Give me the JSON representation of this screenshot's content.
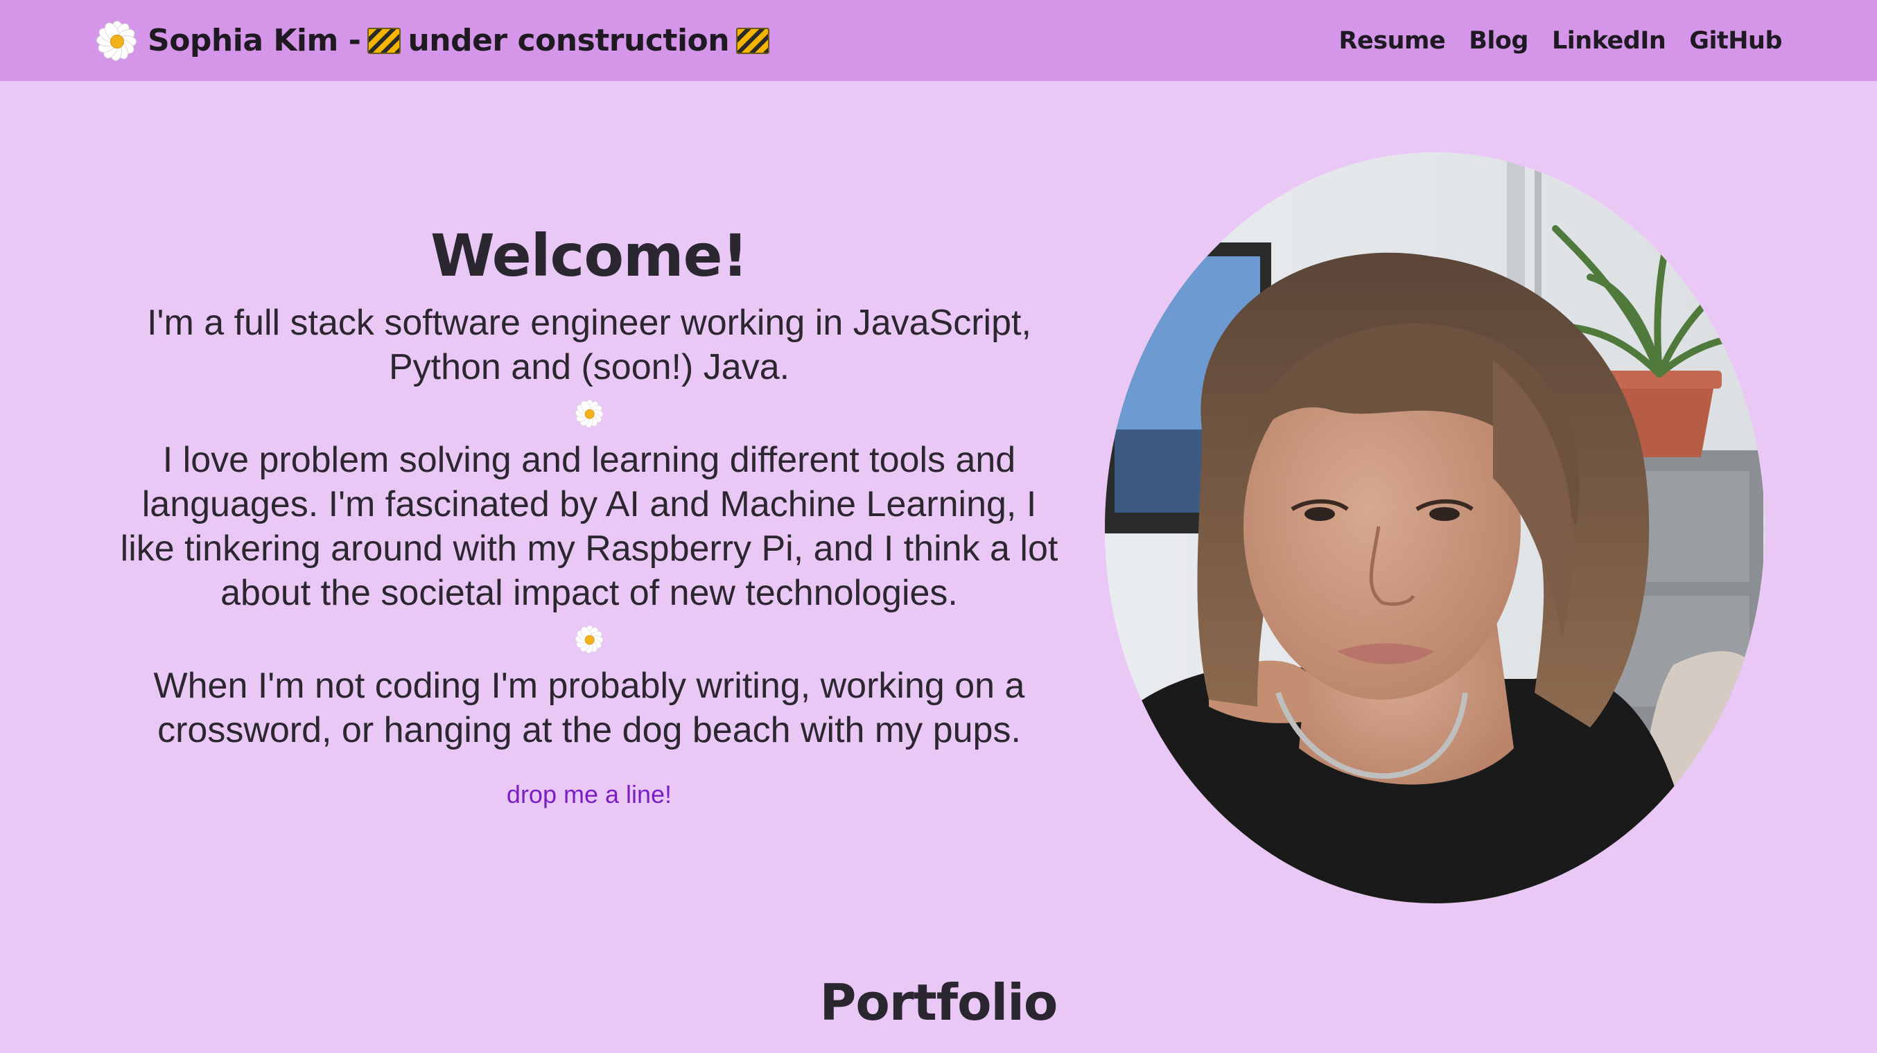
{
  "header": {
    "brand_name": "Sophia Kim -",
    "brand_status": "under construction",
    "nav": [
      "Resume",
      "Blog",
      "LinkedIn",
      "GitHub"
    ]
  },
  "hero": {
    "title": "Welcome!",
    "paragraphs": [
      "I'm a full stack software engineer working in JavaScript, Python and (soon!) Java.",
      "I love problem solving and learning different tools and languages. I'm fascinated by AI and Machine Learning, I like tinkering around with my Raspberry Pi, and I think a lot about the societal impact of new technologies.",
      "When I'm not coding I'm probably writing, working on a crossword, or hanging at the dog beach with my pups."
    ],
    "contact_link": "drop me a line!"
  },
  "sections": {
    "portfolio_title": "Portfolio"
  },
  "icons": {
    "brand_icon": "daisy-icon",
    "status_icons": "construction-sign-icon",
    "separator_icon": "daisy-icon"
  },
  "colors": {
    "page_background": "#e9c8f6",
    "navbar_background": "#d596ea",
    "link_color": "#7b1fc4",
    "text_color": "#2a2730"
  }
}
